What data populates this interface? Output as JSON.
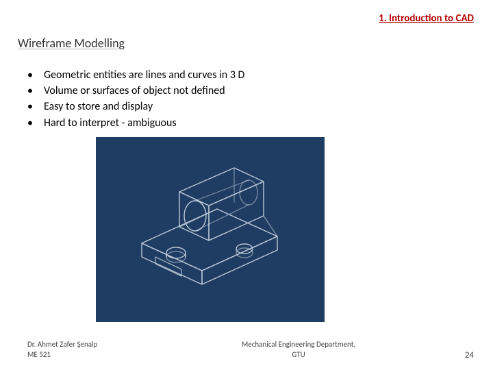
{
  "chapter_title": "1. Introduction to CAD",
  "slide_title": "Wireframe Modelling",
  "bullets": [
    "Geometric entities are lines and curves in 3 D",
    "Volume or surfaces of object not defined",
    "Easy to store and display",
    "Hard to interpret - ambiguous"
  ],
  "figure": {
    "description": "wireframe isometric bracket",
    "bg_color": "#1f3d63",
    "line_color": "#b9c7d6"
  },
  "footer": {
    "author": "Dr. Ahmet Zafer Şenalp",
    "course": "ME 521",
    "department": "Mechanical Engineering Department,",
    "institution": "GTU",
    "page_number": "24"
  }
}
